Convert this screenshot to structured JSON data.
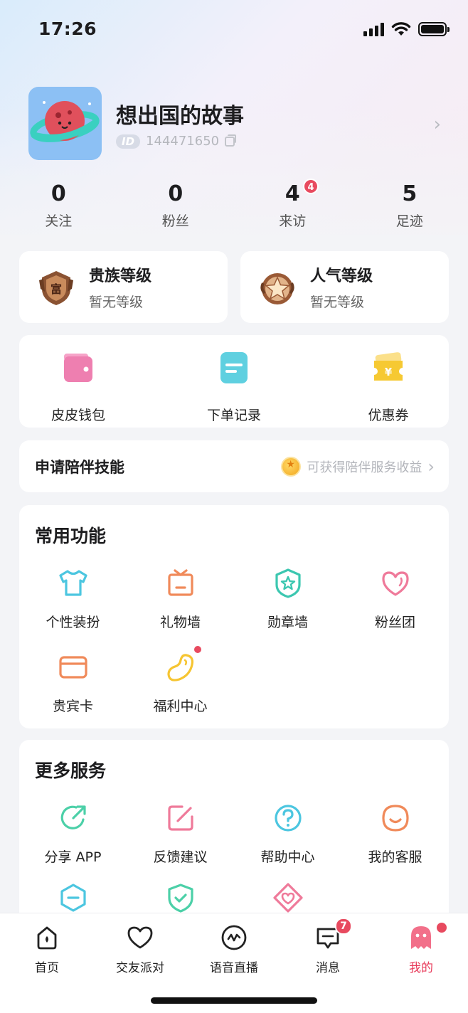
{
  "status_bar": {
    "time": "17:26"
  },
  "profile": {
    "username": "想出国的故事",
    "id_badge": "ID",
    "id_number": "144471650"
  },
  "stats": [
    {
      "value": "0",
      "label": "关注"
    },
    {
      "value": "0",
      "label": "粉丝"
    },
    {
      "value": "4",
      "label": "来访",
      "badge": "4"
    },
    {
      "value": "5",
      "label": "足迹"
    }
  ],
  "levels": [
    {
      "title": "贵族等级",
      "subtitle": "暂无等级",
      "icon": "noble-medal-icon"
    },
    {
      "title": "人气等级",
      "subtitle": "暂无等级",
      "icon": "popularity-star-icon"
    }
  ],
  "quick_actions": [
    {
      "label": "皮皮钱包",
      "icon": "wallet-icon",
      "color": "#ee7fb0"
    },
    {
      "label": "下单记录",
      "icon": "order-record-icon",
      "color": "#5fd0e0"
    },
    {
      "label": "优惠券",
      "icon": "coupon-icon",
      "color": "#f6c932"
    }
  ],
  "apply": {
    "title": "申请陪伴技能",
    "hint": "可获得陪伴服务收益"
  },
  "common": {
    "title": "常用功能",
    "items": [
      {
        "label": "个性装扮",
        "icon": "shirt-icon",
        "color": "#4cc6e0"
      },
      {
        "label": "礼物墙",
        "icon": "gift-wall-icon",
        "color": "#f08a5a"
      },
      {
        "label": "勋章墙",
        "icon": "medal-wall-icon",
        "color": "#3cc7b0"
      },
      {
        "label": "粉丝团",
        "icon": "heart-icon",
        "color": "#ef7a9a"
      },
      {
        "label": "贵宾卡",
        "icon": "vip-card-icon",
        "color": "#f08a5a"
      },
      {
        "label": "福利中心",
        "icon": "welfare-bean-icon",
        "color": "#f6c532"
      }
    ]
  },
  "more": {
    "title": "更多服务",
    "items": [
      {
        "label": "分享 APP",
        "icon": "share-icon",
        "color": "#4cd0a8"
      },
      {
        "label": "反馈建议",
        "icon": "feedback-icon",
        "color": "#ef7a9a"
      },
      {
        "label": "帮助中心",
        "icon": "help-icon",
        "color": "#4cc6e0"
      },
      {
        "label": "我的客服",
        "icon": "customer-service-icon",
        "color": "#f08a5a"
      }
    ],
    "partial_icons": [
      "hexagon-minus-icon",
      "shield-check-icon",
      "diamond-heart-icon"
    ]
  },
  "tabbar": [
    {
      "label": "首页",
      "icon": "home-icon"
    },
    {
      "label": "交友派对",
      "icon": "heart-outline-icon"
    },
    {
      "label": "语音直播",
      "icon": "voice-live-icon"
    },
    {
      "label": "消息",
      "icon": "message-icon",
      "badge": "7"
    },
    {
      "label": "我的",
      "icon": "ghost-icon",
      "active": true
    }
  ],
  "colors": {
    "accent": "#e83a5a",
    "badge": "#e84a5f"
  }
}
